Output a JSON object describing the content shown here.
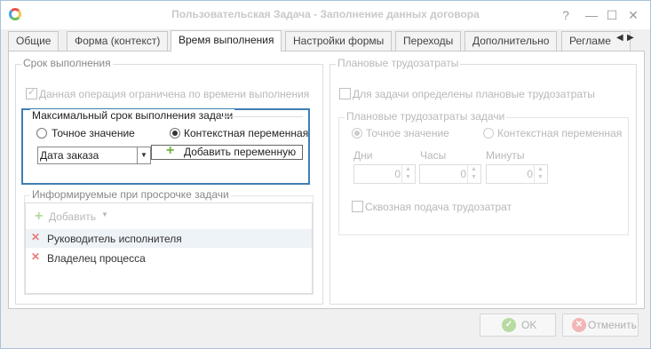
{
  "window": {
    "title": "Пользовательская Задача - Заполнение данных договора",
    "app_icon": "app-logo-icon"
  },
  "title_buttons": {
    "help": "?",
    "minimize": "—",
    "maximize": "☐",
    "close": "✕"
  },
  "tabs": [
    {
      "label": "Общие",
      "active": false
    },
    {
      "label": "Форма (контекст)",
      "active": false
    },
    {
      "label": "Время выполнения",
      "active": true
    },
    {
      "label": "Настройки формы",
      "active": false
    },
    {
      "label": "Переходы",
      "active": false
    },
    {
      "label": "Дополнительно",
      "active": false
    },
    {
      "label": "Регламе",
      "active": false
    }
  ],
  "deadline": {
    "group_title": "Срок выполнения",
    "limited_checkbox": "Данная операция ограничена по времени выполнения",
    "limited_checked": true,
    "max_term": {
      "title": "Максимальный срок выполнения задачи",
      "exact_value": "Точное значение",
      "context_variable": "Контекстная переменная",
      "selected": "context_variable",
      "variable_value": "Дата заказа",
      "add_variable": "Добавить переменную"
    },
    "notified": {
      "title": "Информируемые при просрочке задачи",
      "add": "Добавить",
      "items": [
        "Руководитель исполнителя",
        "Владелец процесса"
      ]
    }
  },
  "planned": {
    "group_title": "Плановые трудозатраты",
    "defined_checkbox": "Для задачи определены плановые трудозатраты",
    "subgroup_title": "Плановые трудозатраты задачи",
    "exact_value": "Точное значение",
    "context_variable": "Контекстная переменная",
    "days_label": "Дни",
    "hours_label": "Часы",
    "minutes_label": "Минуты",
    "days": "0",
    "hours": "0",
    "minutes": "0",
    "end_to_end": "Сквозная подача трудозатрат"
  },
  "footer": {
    "ok": "OK",
    "cancel": "Отменить"
  },
  "colors": {
    "accent": "#3f7fb5",
    "add_green": "#6db33f",
    "remove_red": "#e97b7b"
  }
}
